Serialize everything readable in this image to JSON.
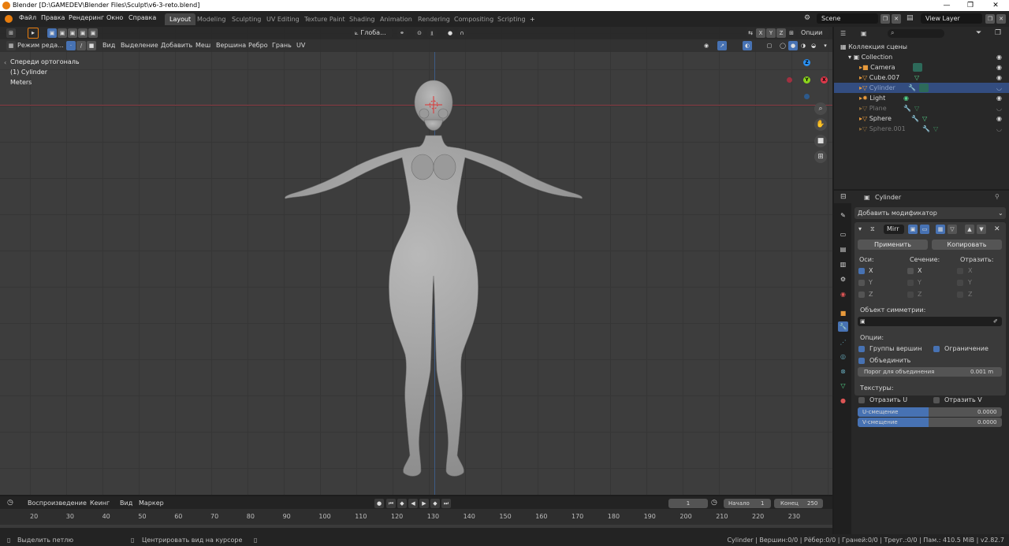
{
  "window": {
    "title": "Blender [D:\\GAMEDEV\\Blender Files\\Sculpt\\v6-3-reto.blend]",
    "minimize": "—",
    "maximize": "❐",
    "close": "✕"
  },
  "menu": [
    "Файл",
    "Правка",
    "Рендеринг",
    "Окно",
    "Справка"
  ],
  "workspaces": [
    "Layout",
    "Modeling",
    "Sculpting",
    "UV Editing",
    "Texture Paint",
    "Shading",
    "Animation",
    "Rendering",
    "Compositing",
    "Scripting"
  ],
  "workspace_add": "+",
  "scene": {
    "name": "Scene",
    "view_layer": "View Layer"
  },
  "viewport_header": {
    "orientation": "Глоба...",
    "options": "Опции",
    "axes": [
      "X",
      "Y",
      "Z"
    ],
    "mode": "Режим реда...",
    "menus": [
      "Вид",
      "Выделение",
      "Добавить",
      "Меш",
      "Вершина",
      "Ребро",
      "Грань",
      "UV"
    ]
  },
  "viewport_overlay": {
    "view_name": "Спереди ортогональ",
    "object": "(1) Cylinder",
    "units": "Meters"
  },
  "gizmo": {
    "x": "X",
    "y": "Y",
    "z": "Z"
  },
  "outliner": {
    "search_placeholder": "",
    "root": "Коллекция сцены",
    "collection": "Collection",
    "items": [
      {
        "name": "Camera",
        "selected": false,
        "disabled": false
      },
      {
        "name": "Cube.007",
        "selected": false,
        "disabled": false
      },
      {
        "name": "Cylinder",
        "selected": true,
        "disabled": true
      },
      {
        "name": "Light",
        "selected": false,
        "disabled": false
      },
      {
        "name": "Plane",
        "selected": false,
        "disabled": true
      },
      {
        "name": "Sphere",
        "selected": false,
        "disabled": false
      },
      {
        "name": "Sphere.001",
        "selected": false,
        "disabled": true
      }
    ]
  },
  "properties": {
    "object_name": "Cylinder",
    "add_modifier": "Добавить модификатор",
    "modifier_name": "Mirr",
    "apply": "Применить",
    "copy": "Копировать",
    "axes_label": "Оси:",
    "bisect_label": "Сечение:",
    "flip_label": "Отразить:",
    "axis_rows": [
      {
        "axis": "X",
        "axes": true,
        "bisect": false,
        "flip": false
      },
      {
        "axis": "Y",
        "axes": false,
        "bisect": false,
        "flip": false
      },
      {
        "axis": "Z",
        "axes": false,
        "bisect": false,
        "flip": false
      }
    ],
    "mirror_object_label": "Объект симметрии:",
    "options_label": "Опции:",
    "vertex_groups": "Группы вершин",
    "clipping": "Ограничение",
    "merge": "Объединить",
    "merge_threshold_label": "Порог для объединения",
    "merge_threshold_value": "0.001 m",
    "textures_label": "Текстуры:",
    "flip_u": "Отразить U",
    "flip_v": "Отразить V",
    "u_offset_label": "U-смещение",
    "u_offset_value": "0.0000",
    "v_offset_label": "V-смещение",
    "v_offset_value": "0.0000"
  },
  "timeline": {
    "playback": "Воспроизведение",
    "keying": "Кеинг",
    "view": "Вид",
    "marker": "Маркер",
    "current_frame": "1",
    "start_label": "Начало",
    "start_value": "1",
    "end_label": "Конец",
    "end_value": "250",
    "ticks": [
      "20",
      "30",
      "40",
      "50",
      "60",
      "70",
      "80",
      "90",
      "100",
      "110",
      "120",
      "130",
      "140",
      "150",
      "160",
      "170",
      "180",
      "190",
      "200",
      "210",
      "220",
      "230"
    ]
  },
  "statusbar": {
    "left": "Выделить петлю",
    "middle": "Центрировать вид на курсоре",
    "right": "Cylinder | Вершин:0/0 | Рёбер:0/0 | Граней:0/0 | Треуг.:0/0 | Пам.: 410.5 MiB | v2.82.7"
  },
  "colors": {
    "accent": "#4772b3",
    "selected_row": "#334d80",
    "x_axis": "#e0394b",
    "y_axis": "#8bd41c",
    "z_axis": "#2a8ff0"
  }
}
